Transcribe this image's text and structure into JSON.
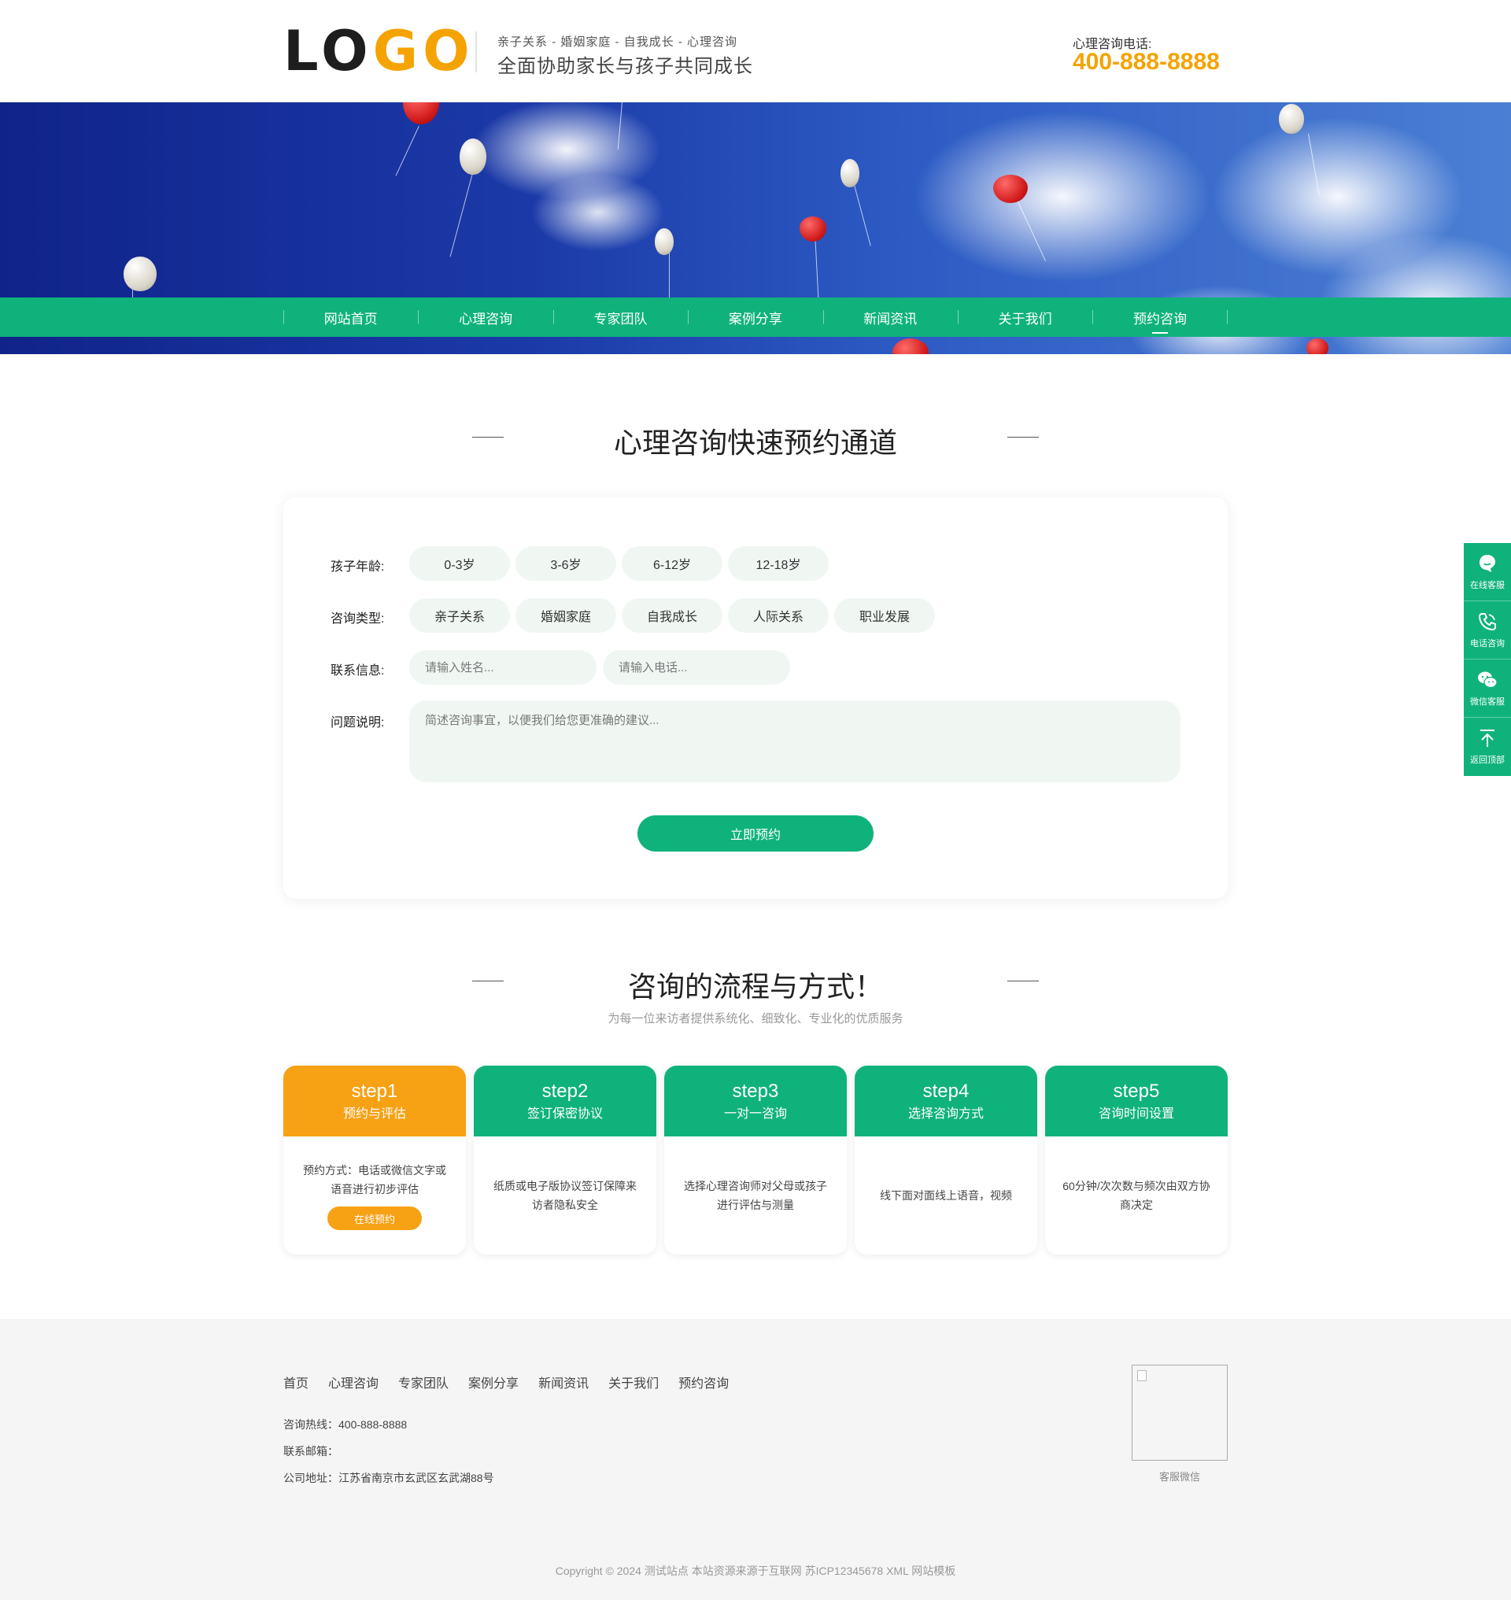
{
  "header": {
    "logo_part1": "LO",
    "logo_part2": "GO",
    "slogan_small": "亲子关系 - 婚姻家庭 - 自我成长 - 心理咨询",
    "slogan_big": "全面协助家长与孩子共同成长",
    "hotline_label": "心理咨询电话:",
    "hotline_number": "400-888-8888"
  },
  "colors": {
    "primary_green": "#10b27c",
    "accent_orange": "#f5a300",
    "step_orange": "#f7a115",
    "footer_bg": "#f5f5f5"
  },
  "nav": {
    "items": [
      {
        "label": "网站首页"
      },
      {
        "label": "心理咨询"
      },
      {
        "label": "专家团队"
      },
      {
        "label": "案例分享"
      },
      {
        "label": "新闻资讯"
      },
      {
        "label": "关于我们"
      },
      {
        "label": "预约咨询",
        "active": true
      }
    ]
  },
  "booking": {
    "title": "心理咨询快速预约通道",
    "age_label": "孩子年龄:",
    "ages": [
      "0-3岁",
      "3-6岁",
      "6-12岁",
      "12-18岁"
    ],
    "type_label": "咨询类型:",
    "types": [
      "亲子关系",
      "婚姻家庭",
      "自我成长",
      "人际关系",
      "职业发展"
    ],
    "contact_label": "联系信息:",
    "name_placeholder": "请输入姓名...",
    "phone_placeholder": "请输入电话...",
    "desc_label": "问题说明:",
    "desc_placeholder": "简述咨询事宜，以便我们给您更准确的建议...",
    "submit_label": "立即预约"
  },
  "process": {
    "title": "咨询的流程与方式！",
    "subtitle": "为每一位来访者提供系统化、细致化、专业化的优质服务",
    "steps": [
      {
        "num": "step1",
        "name": "预约与评估",
        "desc": "预约方式：电话或微信文字或语音进行初步评估",
        "button": "在线预约"
      },
      {
        "num": "step2",
        "name": "签订保密协议",
        "desc": "纸质或电子版协议签订保障来访者隐私安全"
      },
      {
        "num": "step3",
        "name": "一对一咨询",
        "desc": "选择心理咨询师对父母或孩子进行评估与测量"
      },
      {
        "num": "step4",
        "name": "选择咨询方式",
        "desc": "线下面对面线上语音，视频"
      },
      {
        "num": "step5",
        "name": "咨询时间设置",
        "desc": "60分钟/次次数与频次由双方协商决定"
      }
    ]
  },
  "side_float": {
    "items": [
      {
        "label": "在线客服",
        "icon": "chat-bubble-icon"
      },
      {
        "label": "电话咨询",
        "icon": "phone-icon"
      },
      {
        "label": "微信客服",
        "icon": "wechat-icon"
      },
      {
        "label": "返回顶部",
        "icon": "arrow-up-icon"
      }
    ]
  },
  "footer": {
    "nav": [
      "首页",
      "心理咨询",
      "专家团队",
      "案例分享",
      "新闻资讯",
      "关于我们",
      "预约咨询"
    ],
    "hotline": "咨询热线：400-888-8888",
    "email": "联系邮箱：",
    "address": "公司地址：江苏省南京市玄武区玄武湖88号",
    "qr_caption": "客服微信",
    "copyright": "Copyright © 2024 测试站点 本站资源来源于互联网 苏ICP12345678 XML 网站模板"
  }
}
